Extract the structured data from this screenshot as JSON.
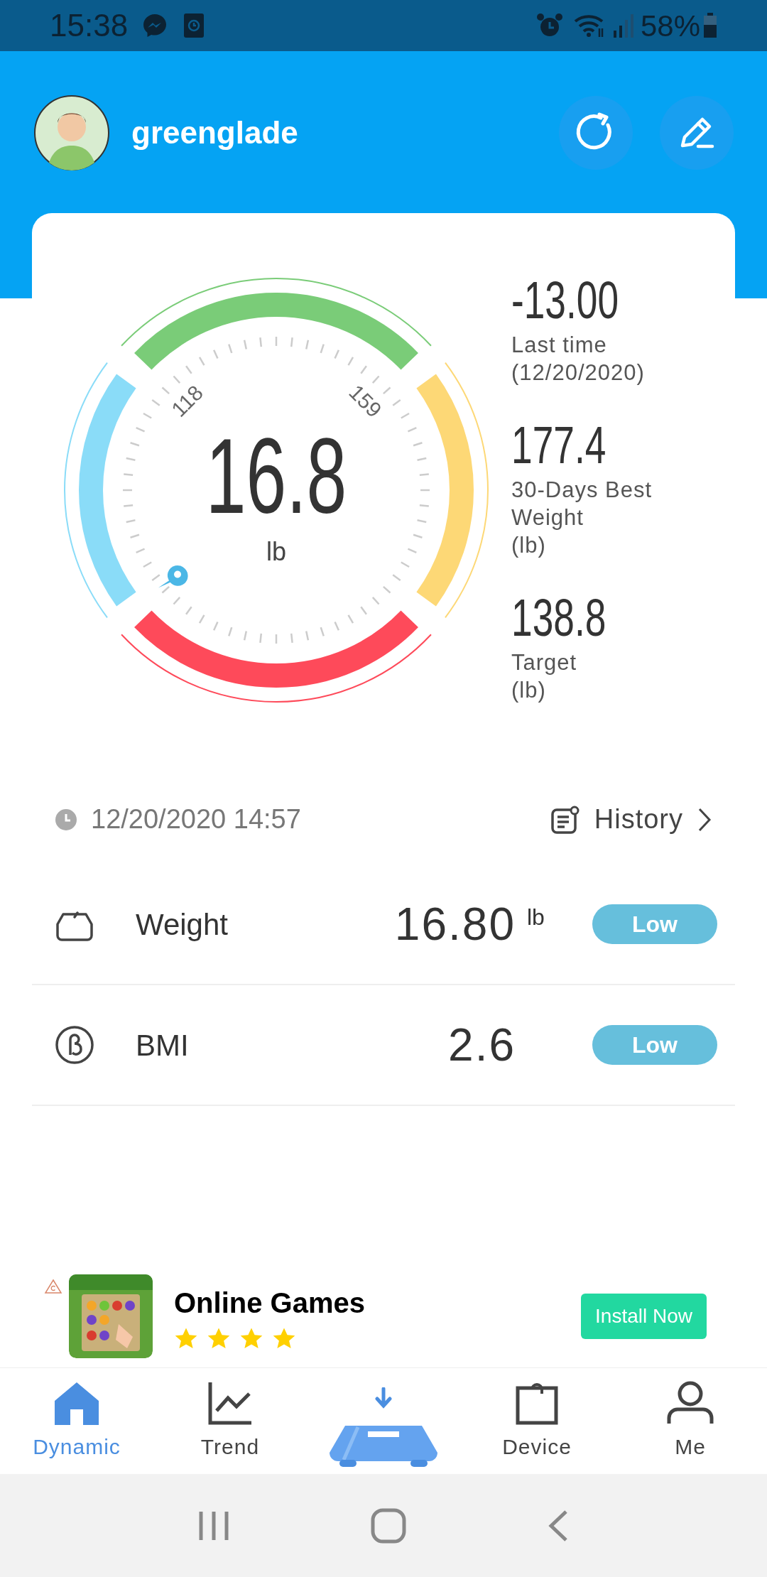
{
  "status_bar": {
    "time": "15:38",
    "battery": "58%"
  },
  "profile": {
    "username": "greenglade"
  },
  "gauge": {
    "value": "16.8",
    "unit": "lb",
    "tick_labels": [
      "118",
      "159"
    ]
  },
  "stats": [
    {
      "value": "-13.00",
      "lines": [
        "Last time",
        "(12/20/2020)"
      ]
    },
    {
      "value": "177.4",
      "lines": [
        "30-Days Best",
        "Weight",
        "(lb)"
      ]
    },
    {
      "value": "138.8",
      "lines": [
        "Target",
        "(lb)"
      ]
    }
  ],
  "measurement": {
    "timestamp": "12/20/2020 14:57",
    "history_link": "History"
  },
  "metrics": [
    {
      "kind": "weight",
      "label": "Weight",
      "value": "16.80",
      "unit": "lb",
      "status": "Low"
    },
    {
      "kind": "bmi",
      "label": "BMI",
      "value": "2.6",
      "status": "Low"
    }
  ],
  "ad": {
    "title": "Online Games",
    "stars": 4,
    "button": "Install Now"
  },
  "nav": [
    {
      "kind": "home",
      "label": "Dynamic",
      "selected": true
    },
    {
      "kind": "trend",
      "label": "Trend",
      "selected": false
    },
    {
      "kind": "scale",
      "selected": false
    },
    {
      "kind": "device",
      "label": "Device",
      "selected": false
    },
    {
      "kind": "me",
      "label": "Me",
      "selected": false
    }
  ]
}
